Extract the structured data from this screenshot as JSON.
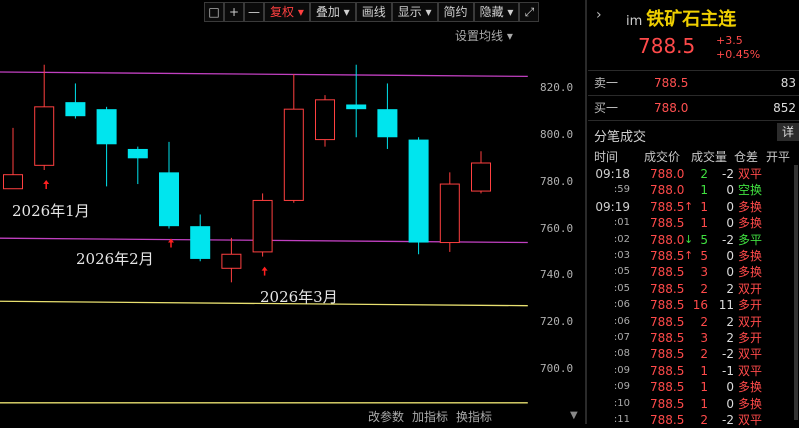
{
  "toolbar": {
    "icon_square": "□",
    "icon_plus": "+",
    "icon_minus": "—",
    "fuquan": "复权 ▾",
    "diejia": "叠加 ▾",
    "huaxian": "画线",
    "xianshi": "显示 ▾",
    "jianyue": "简约",
    "yincang": "隐藏 ▾",
    "icon_expand": "⤢"
  },
  "chart": {
    "settings_label": "设置均线 ▾",
    "ylim": [
      685,
      838
    ],
    "y_ticks": [
      "820.0",
      "800.0",
      "780.0",
      "760.0",
      "740.0",
      "720.0",
      "700.0"
    ],
    "y_tick_values": [
      820,
      800,
      780,
      760,
      740,
      720,
      700
    ],
    "month_labels": [
      "2026年1月",
      "2026年2月",
      "2026年3月"
    ],
    "bottom_buttons": [
      "改参数",
      "加指标",
      "换指标"
    ],
    "up_color": "#ff4040",
    "down_color": "#00e5ee",
    "candles": [
      {
        "o": 777,
        "c": 783,
        "h": 803,
        "l": 777
      },
      {
        "o": 787,
        "c": 812,
        "h": 830,
        "l": 785
      },
      {
        "o": 814,
        "c": 808,
        "h": 822,
        "l": 807
      },
      {
        "o": 811,
        "c": 796,
        "h": 812,
        "l": 778
      },
      {
        "o": 794,
        "c": 790,
        "h": 795,
        "l": 779
      },
      {
        "o": 784,
        "c": 761,
        "h": 797,
        "l": 760
      },
      {
        "o": 761,
        "c": 747,
        "h": 766,
        "l": 746
      },
      {
        "o": 743,
        "c": 749,
        "h": 756,
        "l": 737
      },
      {
        "o": 750,
        "c": 772,
        "h": 775,
        "l": 748
      },
      {
        "o": 772,
        "c": 811,
        "h": 826,
        "l": 771
      },
      {
        "o": 798,
        "c": 815,
        "h": 817,
        "l": 795
      },
      {
        "o": 813,
        "c": 811,
        "h": 830,
        "l": 799
      },
      {
        "o": 811,
        "c": 799,
        "h": 822,
        "l": 794
      },
      {
        "o": 798,
        "c": 754,
        "h": 799,
        "l": 749
      },
      {
        "o": 754,
        "c": 779,
        "h": 784,
        "l": 750
      },
      {
        "o": 776,
        "c": 788,
        "h": 793,
        "l": 775
      }
    ],
    "arrow_candles": [
      1,
      5,
      8
    ],
    "upper_band": [
      {
        "i": -1.5,
        "v": 827
      },
      {
        "i": 16.5,
        "v": 825
      }
    ],
    "lower_band": [
      {
        "i": -1.5,
        "v": 756
      },
      {
        "i": 16.5,
        "v": 754
      }
    ],
    "yellow_line": [
      {
        "i": -1.5,
        "v": 729
      },
      {
        "i": 16.5,
        "v": 727
      }
    ],
    "bottom_line": [
      {
        "i": -1.5,
        "v": 685.5
      },
      {
        "i": 16.5,
        "v": 685.5
      }
    ]
  },
  "quote": {
    "prefix": "im",
    "name": "铁矿石主连",
    "price": "788.5",
    "change": "+3.5",
    "change_pct": "+0.45%",
    "sell_label": "卖一",
    "sell_price": "788.5",
    "sell_vol": "83",
    "buy_label": "买一",
    "buy_price": "788.0",
    "buy_vol": "852"
  },
  "trades": {
    "title": "分笔成交",
    "detail_btn": "详",
    "headers": [
      "时间",
      "成交价",
      "成交量",
      "仓差",
      "开平"
    ],
    "rows": [
      {
        "time": "09:18",
        "price": "788.0",
        "arrow": "",
        "vol": "2",
        "oi": "-2",
        "type": "双平",
        "type_color": "#ff4a4a",
        "vol_color": "#40e040"
      },
      {
        "time": ":59",
        "price": "788.0",
        "arrow": "",
        "vol": "1",
        "oi": "0",
        "type": "空换",
        "type_color": "#40e040",
        "vol_color": "#40e040"
      },
      {
        "time": "09:19",
        "price": "788.5",
        "arrow": "↑",
        "vol": "1",
        "oi": "0",
        "type": "多换",
        "type_color": "#ff4a4a",
        "vol_color": "#ff4a4a"
      },
      {
        "time": ":01",
        "price": "788.5",
        "arrow": "",
        "vol": "1",
        "oi": "0",
        "type": "多换",
        "type_color": "#ff4a4a",
        "vol_color": "#ff4a4a"
      },
      {
        "time": ":02",
        "price": "788.0",
        "arrow": "↓",
        "vol": "5",
        "oi": "-2",
        "type": "多平",
        "type_color": "#40e040",
        "vol_color": "#40e040"
      },
      {
        "time": ":03",
        "price": "788.5",
        "arrow": "↑",
        "vol": "5",
        "oi": "0",
        "type": "多换",
        "type_color": "#ff4a4a",
        "vol_color": "#ff4a4a"
      },
      {
        "time": ":05",
        "price": "788.5",
        "arrow": "",
        "vol": "3",
        "oi": "0",
        "type": "多换",
        "type_color": "#ff4a4a",
        "vol_color": "#ff4a4a"
      },
      {
        "time": ":05",
        "price": "788.5",
        "arrow": "",
        "vol": "2",
        "oi": "2",
        "type": "双开",
        "type_color": "#ff4a4a",
        "vol_color": "#ff4a4a"
      },
      {
        "time": ":06",
        "price": "788.5",
        "arrow": "",
        "vol": "16",
        "oi": "11",
        "type": "多开",
        "type_color": "#ff4a4a",
        "vol_color": "#ff4a4a"
      },
      {
        "time": ":06",
        "price": "788.5",
        "arrow": "",
        "vol": "2",
        "oi": "2",
        "type": "双开",
        "type_color": "#ff4a4a",
        "vol_color": "#ff4a4a"
      },
      {
        "time": ":07",
        "price": "788.5",
        "arrow": "",
        "vol": "3",
        "oi": "2",
        "type": "多开",
        "type_color": "#ff4a4a",
        "vol_color": "#ff4a4a"
      },
      {
        "time": ":08",
        "price": "788.5",
        "arrow": "",
        "vol": "2",
        "oi": "-2",
        "type": "双平",
        "type_color": "#ff4a4a",
        "vol_color": "#ff4a4a"
      },
      {
        "time": ":09",
        "price": "788.5",
        "arrow": "",
        "vol": "1",
        "oi": "-1",
        "type": "双平",
        "type_color": "#ff4a4a",
        "vol_color": "#ff4a4a"
      },
      {
        "time": ":09",
        "price": "788.5",
        "arrow": "",
        "vol": "1",
        "oi": "0",
        "type": "多换",
        "type_color": "#ff4a4a",
        "vol_color": "#ff4a4a"
      },
      {
        "time": ":10",
        "price": "788.5",
        "arrow": "",
        "vol": "1",
        "oi": "0",
        "type": "多换",
        "type_color": "#ff4a4a",
        "vol_color": "#ff4a4a"
      },
      {
        "time": ":11",
        "price": "788.5",
        "arrow": "",
        "vol": "2",
        "oi": "-2",
        "type": "双平",
        "type_color": "#ff4a4a",
        "vol_color": "#ff4a4a"
      }
    ]
  }
}
